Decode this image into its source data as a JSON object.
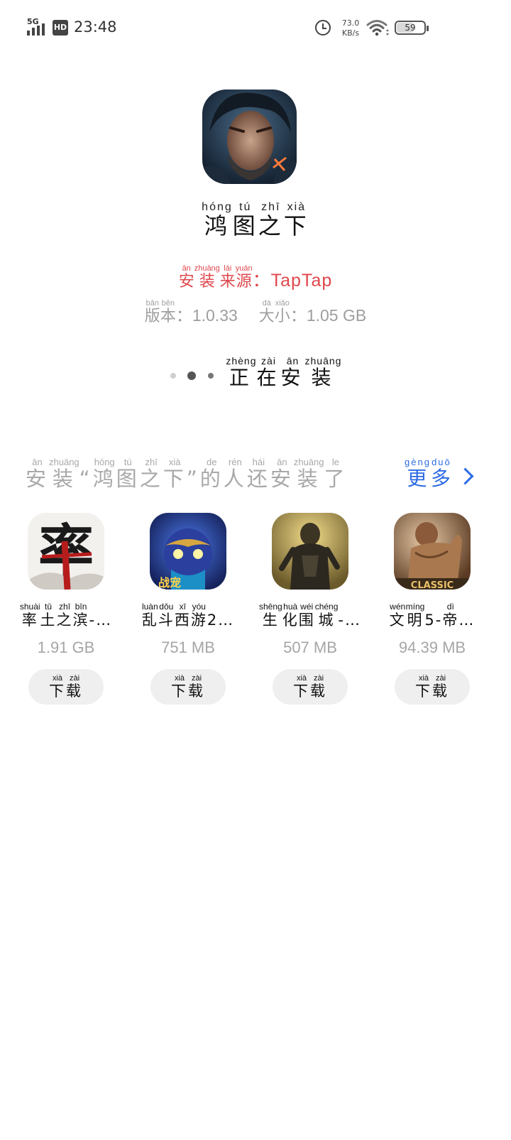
{
  "status_bar": {
    "network": "5G",
    "hd_badge": "HD",
    "time": "23:48",
    "speed_value": "73.0",
    "speed_unit": "KB/s",
    "battery": "59"
  },
  "app": {
    "name": [
      {
        "char": "鸿",
        "pinyin": "hóng"
      },
      {
        "char": "图",
        "pinyin": "tú"
      },
      {
        "char": "之",
        "pinyin": "zhī"
      },
      {
        "char": "下",
        "pinyin": "xià"
      }
    ],
    "source_label": [
      {
        "char": "安",
        "pinyin": "ān"
      },
      {
        "char": "装",
        "pinyin": "zhuāng"
      },
      {
        "char": "来",
        "pinyin": "lái"
      },
      {
        "char": "源",
        "pinyin": "yuán"
      }
    ],
    "source_value": "：TapTap",
    "version_label": [
      {
        "char": "版",
        "pinyin": "bǎn"
      },
      {
        "char": "本",
        "pinyin": "běn"
      }
    ],
    "version_value": "：1.0.33",
    "size_label": [
      {
        "char": "大",
        "pinyin": "dà"
      },
      {
        "char": "小",
        "pinyin": "xiǎo"
      }
    ],
    "size_value": "：1.05 GB"
  },
  "progress": {
    "status": [
      {
        "char": "正",
        "pinyin": "zhèng"
      },
      {
        "char": "在",
        "pinyin": "zài"
      },
      {
        "char": "安",
        "pinyin": "ān"
      },
      {
        "char": "装",
        "pinyin": "zhuāng"
      }
    ]
  },
  "recommend": {
    "title": [
      {
        "char": "安",
        "pinyin": "ān"
      },
      {
        "char": "装",
        "pinyin": "zhuāng"
      },
      {
        "char": "“",
        "pinyin": ""
      },
      {
        "char": "鸿",
        "pinyin": "hóng"
      },
      {
        "char": "图",
        "pinyin": "tú"
      },
      {
        "char": "之",
        "pinyin": "zhī"
      },
      {
        "char": "下",
        "pinyin": "xià"
      },
      {
        "char": "”",
        "pinyin": ""
      },
      {
        "char": "的",
        "pinyin": "de"
      },
      {
        "char": "人",
        "pinyin": "rén"
      },
      {
        "char": "还",
        "pinyin": "hái"
      },
      {
        "char": "安",
        "pinyin": "ān"
      },
      {
        "char": "装",
        "pinyin": "zhuāng"
      },
      {
        "char": "了",
        "pinyin": "le"
      }
    ],
    "more": [
      {
        "char": "更",
        "pinyin": "gèng"
      },
      {
        "char": "多",
        "pinyin": "duō"
      }
    ],
    "download_label": [
      {
        "char": "下",
        "pinyin": "xià"
      },
      {
        "char": "载",
        "pinyin": "zài"
      }
    ],
    "apps": [
      {
        "name": [
          {
            "char": "率",
            "pinyin": "shuài"
          },
          {
            "char": "土",
            "pinyin": "tǔ"
          },
          {
            "char": "之",
            "pinyin": "zhī"
          },
          {
            "char": "滨",
            "pinyin": "bīn"
          },
          {
            "char": "-…",
            "pinyin": ""
          }
        ],
        "size": "1.91 GB"
      },
      {
        "name": [
          {
            "char": "乱",
            "pinyin": "luàn"
          },
          {
            "char": "斗",
            "pinyin": "dǒu"
          },
          {
            "char": "西",
            "pinyin": "xī"
          },
          {
            "char": "游",
            "pinyin": "yóu"
          },
          {
            "char": "2…",
            "pinyin": ""
          }
        ],
        "size": "751 MB"
      },
      {
        "name": [
          {
            "char": "生",
            "pinyin": "shēng"
          },
          {
            "char": "化",
            "pinyin": "huà"
          },
          {
            "char": "围",
            "pinyin": "wéi"
          },
          {
            "char": "城",
            "pinyin": "chéng"
          },
          {
            "char": "-…",
            "pinyin": ""
          }
        ],
        "size": "507 MB"
      },
      {
        "name": [
          {
            "char": "文",
            "pinyin": "wén"
          },
          {
            "char": "明",
            "pinyin": "míng"
          },
          {
            "char": "5-",
            "pinyin": ""
          },
          {
            "char": "帝",
            "pinyin": "dì"
          },
          {
            "char": "…",
            "pinyin": ""
          }
        ],
        "size": "94.39 MB"
      }
    ]
  }
}
